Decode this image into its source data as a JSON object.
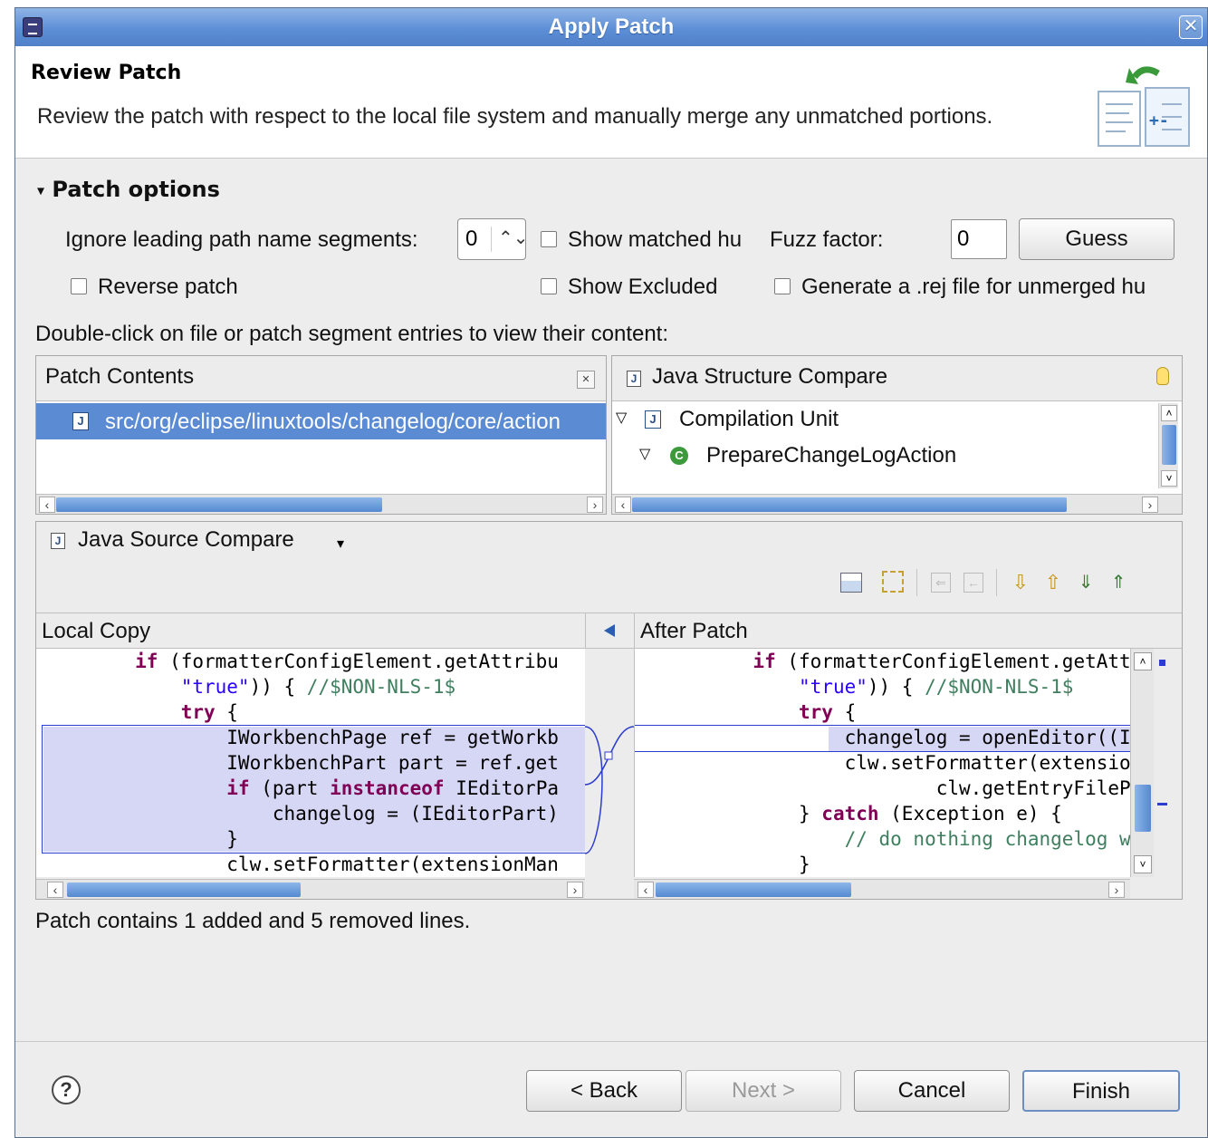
{
  "window": {
    "title": "Apply Patch"
  },
  "header": {
    "title": "Review Patch",
    "description": "Review the patch with respect to the local file system and manually merge any unmatched portions."
  },
  "options": {
    "section_title": "Patch options",
    "ignore_label": "Ignore leading path name segments:",
    "ignore_value": "0",
    "show_matched_label": "Show matched hu",
    "fuzz_label": "Fuzz factor:",
    "fuzz_value": "0",
    "guess_label": "Guess",
    "reverse_label": "Reverse patch",
    "show_excluded_label": "Show Excluded",
    "generate_rej_label": "Generate a .rej file for unmerged hu"
  },
  "instruction": "Double-click on file or patch segment entries to view their content:",
  "patch_contents": {
    "title": "Patch Contents",
    "items": [
      "src/org/eclipse/linuxtools/changelog/core/action"
    ]
  },
  "structure_compare": {
    "title": "Java Structure Compare",
    "tree": [
      "Compilation Unit",
      "PrepareChangeLogAction"
    ]
  },
  "source_compare": {
    "title": "Java Source Compare",
    "left_title": "Local Copy",
    "right_title": "After Patch"
  },
  "status": "Patch contains 1 added and 5 removed lines.",
  "buttons": {
    "back": "< Back",
    "next": "Next >",
    "cancel": "Cancel",
    "finish": "Finish"
  }
}
